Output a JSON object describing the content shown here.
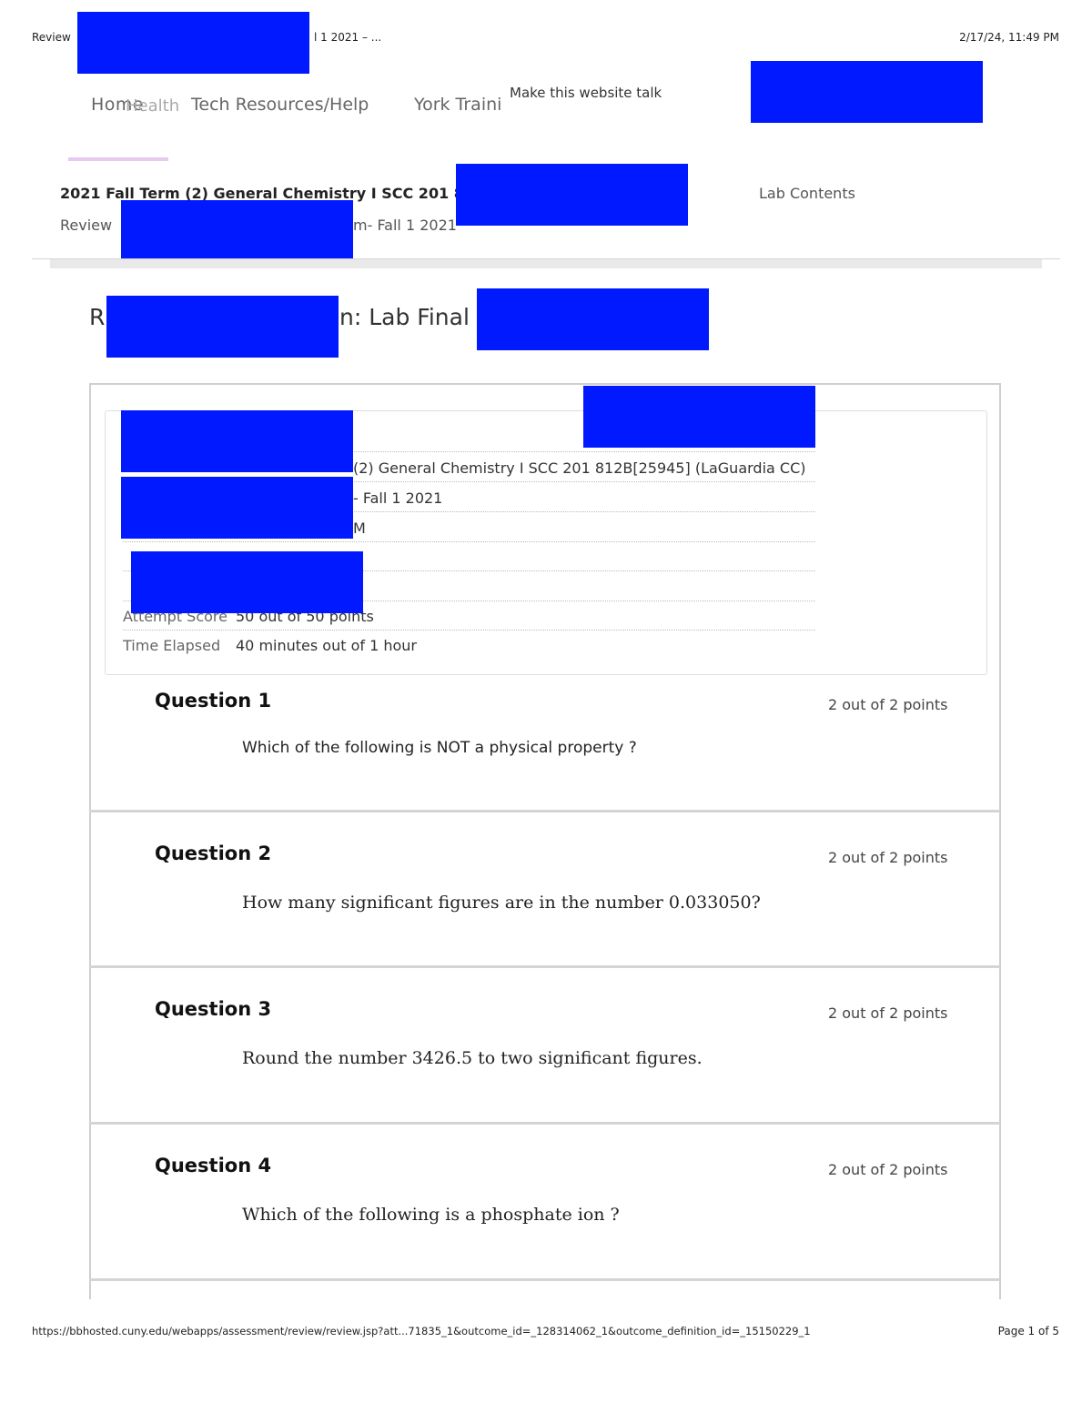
{
  "print_header": {
    "left_start": "Review",
    "left_end": "l 1 2021 – ...",
    "datetime": "2/17/24, 11:49 PM"
  },
  "nav": {
    "home": "Home",
    "overlap": "Health",
    "tech_resources": "Tech Resources/Help",
    "york_training": "York Traini",
    "speak_popup": "Make this website talk"
  },
  "course": {
    "course_line": "2021 Fall Term (2) General Chemistry I SCC 201 81",
    "breadcrumb_start": "Review",
    "breadcrumb_end": "m- Fall 1 2021",
    "lab_contents": "Lab Contents"
  },
  "page": {
    "title_start": "R",
    "title_mid": "n: Lab Final"
  },
  "details": {
    "course_value": "(2) General Chemistry I SCC 201 812B[25945] (LaGuardia CC)",
    "test_value": "- Fall 1 2021",
    "started_value": "M",
    "attempt_score_label": "Attempt Score",
    "attempt_score_value": "50 out of 50 points",
    "time_elapsed_label": "Time Elapsed",
    "time_elapsed_value": "40 minutes out of 1 hour"
  },
  "questions": [
    {
      "title": "Question 1",
      "points": "2 out of 2 points",
      "text": "Which of the following is NOT a physical property ?"
    },
    {
      "title": "Question 2",
      "points": "2 out of 2 points",
      "text": "How many significant figures are in the number 0.033050?"
    },
    {
      "title": "Question 3",
      "points": "2 out of 2 points",
      "text": "Round the number 3426.5 to two significant figures."
    },
    {
      "title": "Question 4",
      "points": "2 out of 2 points",
      "text": "Which of the following is a phosphate ion ?"
    }
  ],
  "print_footer": {
    "url": "https://bbhosted.cuny.edu/webapps/assessment/review/review.jsp?att...71835_1&outcome_id=_128314062_1&outcome_definition_id=_15150229_1",
    "page": "Page 1 of 5"
  },
  "colors": {
    "redaction": "#0019ff",
    "nav_underline": "#e6c9ee"
  }
}
